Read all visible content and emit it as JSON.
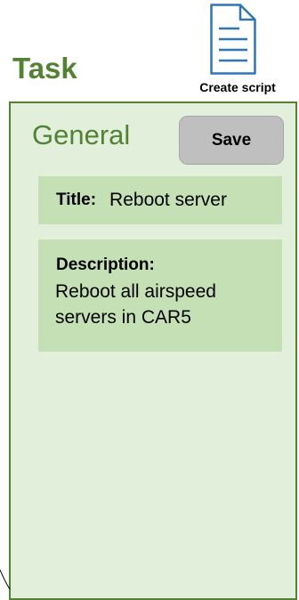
{
  "header": {
    "title": "Task",
    "create_script": {
      "label": "Create script",
      "icon": "document-icon"
    }
  },
  "panel": {
    "heading": "General",
    "save_label": "Save",
    "title_field": {
      "label": "Title:",
      "value": "Reboot server"
    },
    "description_field": {
      "label": "Description:",
      "value": "Reboot all airspeed servers in CAR5"
    }
  },
  "colors": {
    "accent_green": "#538135",
    "panel_background": "#e2efda",
    "field_background": "#c5e0b4",
    "button_gray": "#bfbfbf",
    "icon_blue": "#2e75b6"
  }
}
